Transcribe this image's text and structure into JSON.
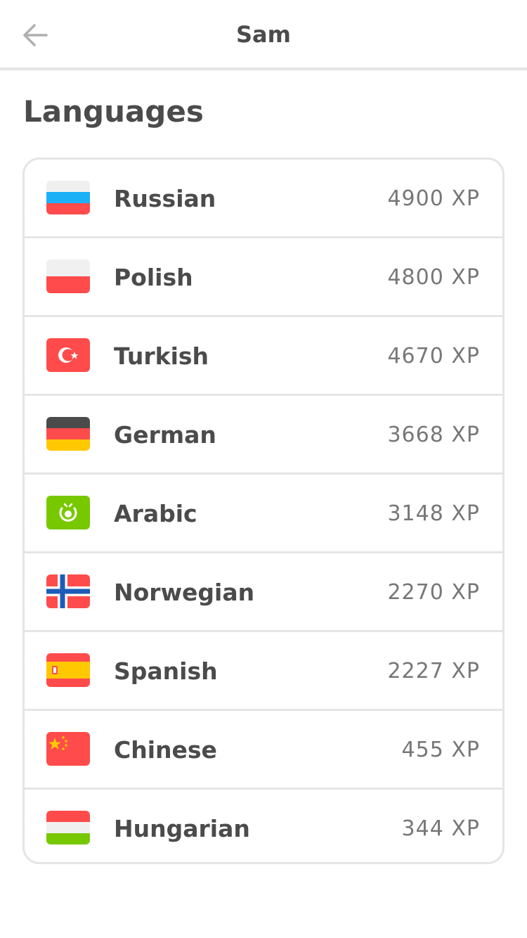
{
  "header": {
    "title": "Sam",
    "back_icon": "arrow-left-icon"
  },
  "section": {
    "title": "Languages"
  },
  "languages": [
    {
      "name": "Russian",
      "xp": "4900 XP",
      "flag": "russia-flag-icon"
    },
    {
      "name": "Polish",
      "xp": "4800 XP",
      "flag": "poland-flag-icon"
    },
    {
      "name": "Turkish",
      "xp": "4670 XP",
      "flag": "turkey-flag-icon"
    },
    {
      "name": "German",
      "xp": "3668 XP",
      "flag": "germany-flag-icon"
    },
    {
      "name": "Arabic",
      "xp": "3148 XP",
      "flag": "arabic-flag-icon"
    },
    {
      "name": "Norwegian",
      "xp": "2270 XP",
      "flag": "norway-flag-icon"
    },
    {
      "name": "Spanish",
      "xp": "2227 XP",
      "flag": "spain-flag-icon"
    },
    {
      "name": "Chinese",
      "xp": "455 XP",
      "flag": "china-flag-icon"
    },
    {
      "name": "Hungarian",
      "xp": "344 XP",
      "flag": "hungary-flag-icon"
    }
  ],
  "colors": {
    "border": "#e5e5e5",
    "text": "#4b4b4b",
    "muted": "#777777"
  }
}
